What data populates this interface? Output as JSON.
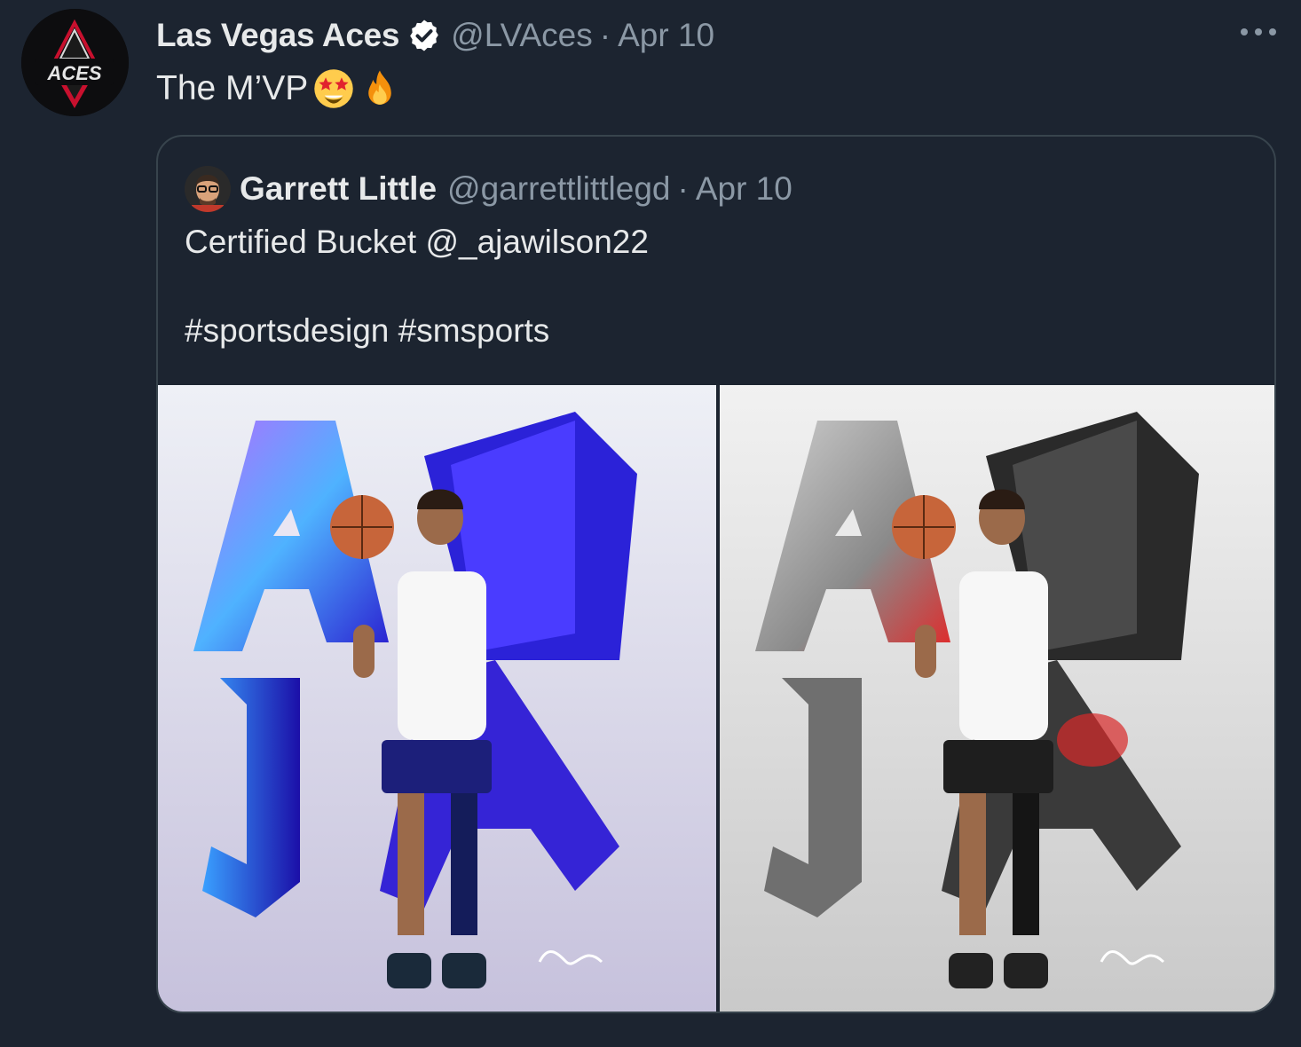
{
  "tweet": {
    "author": {
      "display_name": "Las Vegas Aces",
      "handle": "@LVAces",
      "avatar_text": "ACES",
      "verified": true
    },
    "separator": "·",
    "date": "Apr 10",
    "text": "The M’VP",
    "emojis": [
      "star-struck-emoji",
      "fire-emoji"
    ]
  },
  "quoted_tweet": {
    "author": {
      "display_name": "Garrett Little",
      "handle": "@garrettlittlegd"
    },
    "separator": "·",
    "date": "Apr 10",
    "text": "Certified Bucket @_ajawilson22\n\n#sportsdesign #smsports",
    "media": [
      {
        "name": "aja-color-poster",
        "letters": "AJA",
        "palette": "blue-purple"
      },
      {
        "name": "aja-mono-poster",
        "letters": "AJA",
        "palette": "grey-red"
      }
    ]
  },
  "colors": {
    "background": "#1c2430",
    "primary_text": "#e7e9ea",
    "secondary_text": "#8b98a5",
    "border": "#38444d",
    "verified_badge": "#ffffff"
  }
}
